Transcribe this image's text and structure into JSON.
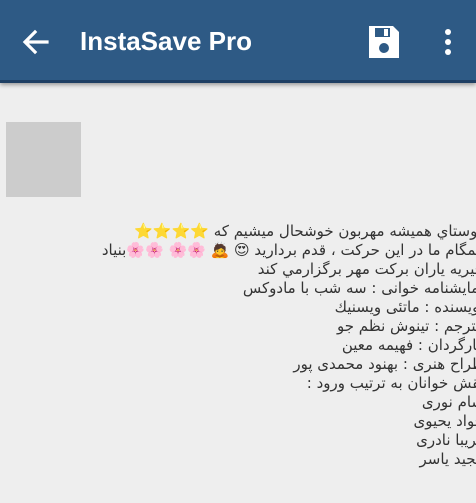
{
  "appbar": {
    "title": "InstaSave Pro",
    "back_icon": "arrow-left-icon",
    "save_icon": "floppy-disk-icon",
    "menu_icon": "more-vert-icon",
    "color": "#2e5a85"
  },
  "caption": {
    "line1_text": "دوستاي هميشه مهربون خوشحال ميشيم كه",
    "line1_stars": "⭐⭐⭐⭐",
    "line2": "همگام ما در اين حركت ، قدم برداريد 😍 🙇 🌸🌸 🌸🌸بنياد",
    "line3": "خيريه ياران بركت مهر برگزارمي كند",
    "line4": "نمايشنامه خوانى : سه شب با مادوكس",
    "line5": "نويسنده : ماتئى ويسنيك",
    "line6": "مترجم : تينوش نظم جو",
    "line7": "كارگردان : فهيمه معين",
    "line8": "طراح هنرى : بهنود محمدى پور",
    "line9": "نقش خوانان به ترتيب ورود :",
    "line10": "سام نورى",
    "line11": "جواد يحيوى",
    "line12": "فريبا نادرى",
    "line13": "مجيد ياسر"
  }
}
